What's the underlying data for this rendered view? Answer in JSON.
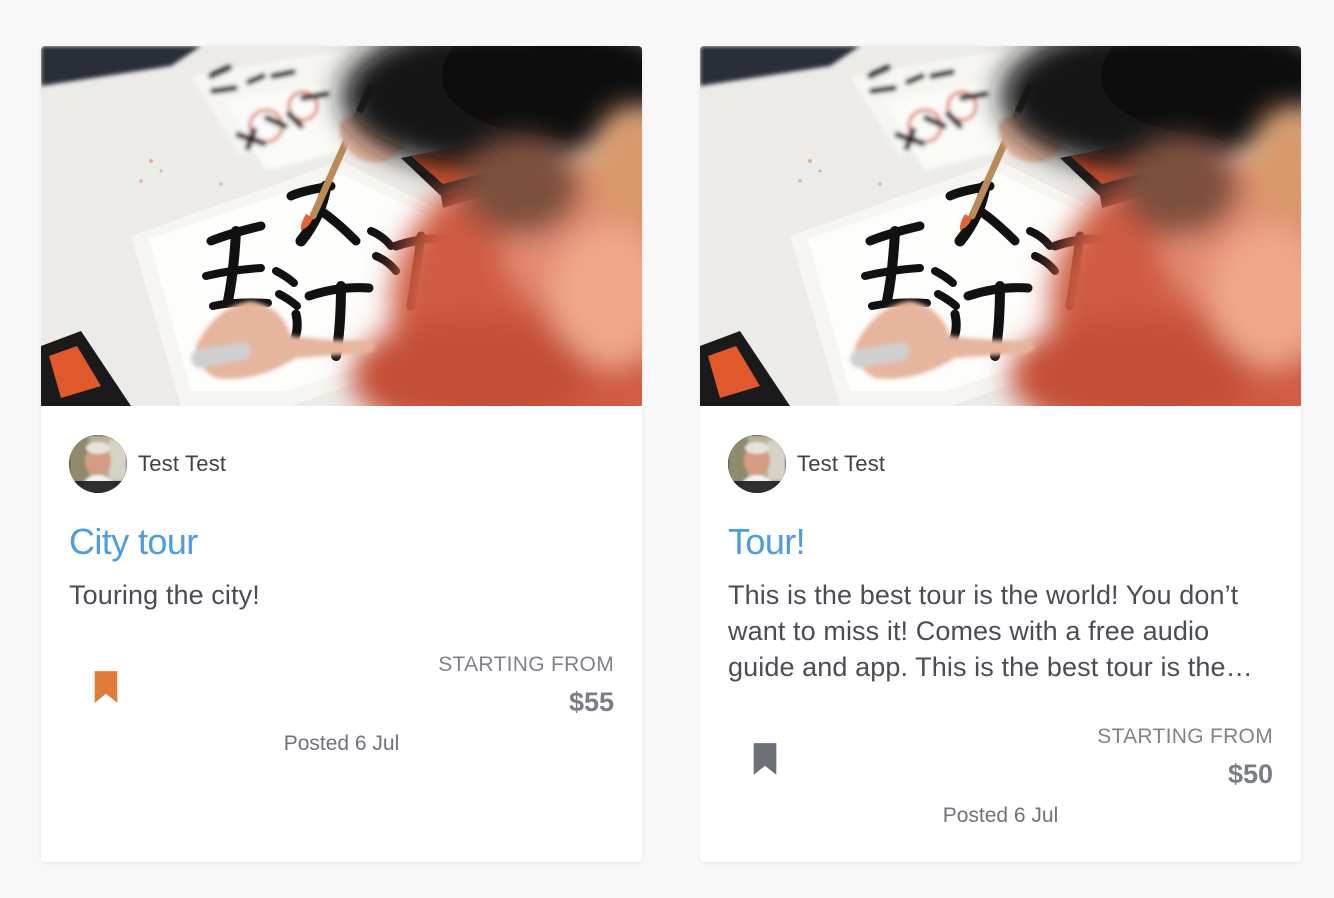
{
  "cards": [
    {
      "author": "Test Test",
      "title": "City tour",
      "description": "Touring the city!",
      "bookmarked": true,
      "bookmark_color": "#e07b39",
      "starting_label": "STARTING FROM",
      "price": "$55",
      "posted": "Posted 6 Jul"
    },
    {
      "author": "Test Test",
      "title": "Tour!",
      "description": "This is the best tour is the world! You don’t want to miss it! Comes with a free audio guide and app. This is the best tour is the world! You don’t want to miss it!",
      "bookmarked": false,
      "bookmark_color": "#6c7079",
      "starting_label": "STARTING FROM",
      "price": "$50",
      "posted": "Posted 6 Jul"
    }
  ],
  "colors": {
    "title": "#4d9be0",
    "background": "#f8f8f8"
  }
}
